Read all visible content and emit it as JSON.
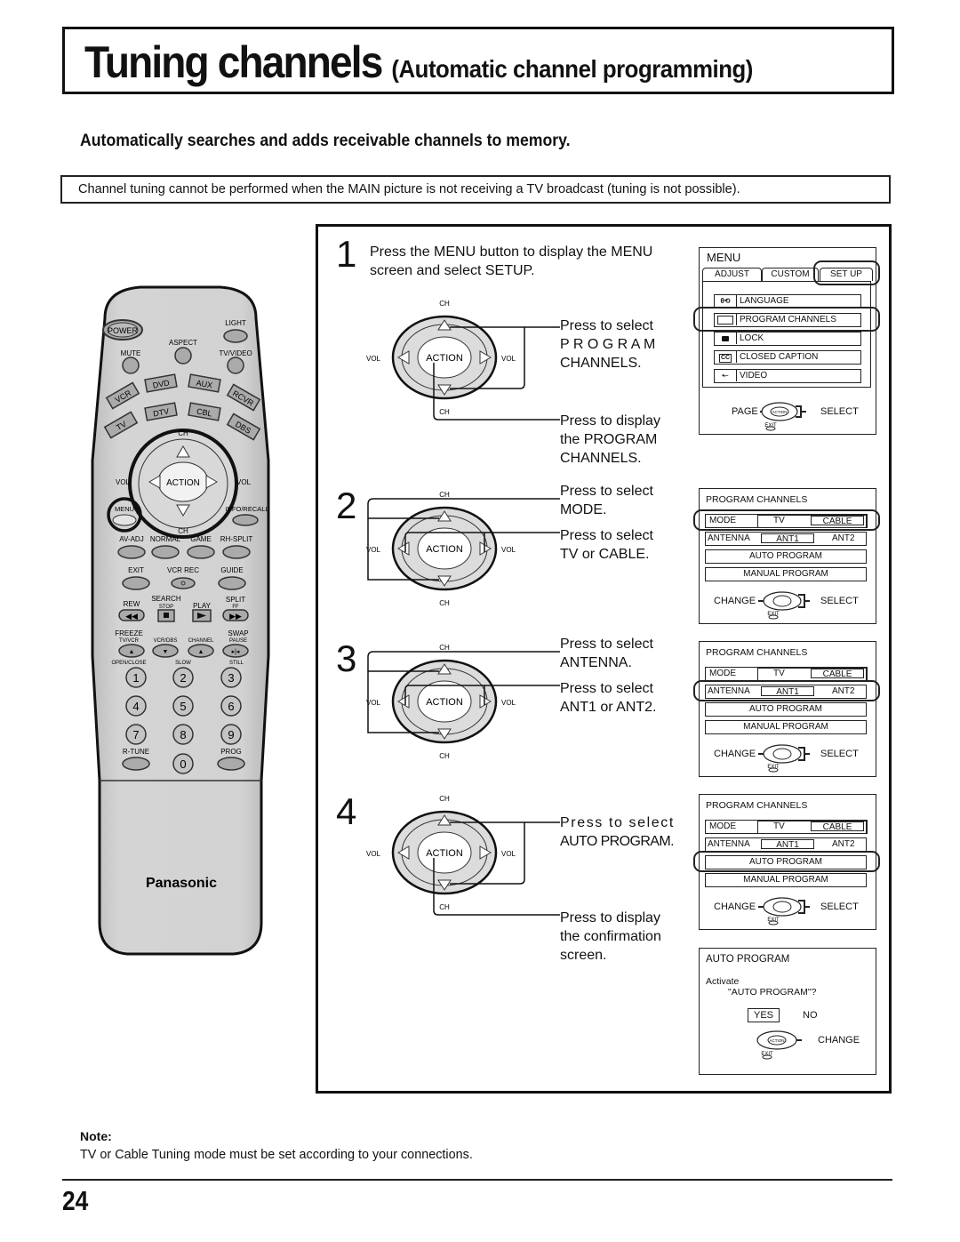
{
  "header": {
    "title": "Tuning channels",
    "subtitle": "(Automatic channel programming)"
  },
  "subheading": "Automatically searches and adds receivable channels to memory.",
  "notice": "Channel tuning cannot be performed when the MAIN picture is not receiving a TV broadcast (tuning is not possible).",
  "remote": {
    "brand": "Panasonic",
    "buttons": {
      "power": "POWER",
      "light": "LIGHT",
      "aspect": "ASPECT",
      "mute": "MUTE",
      "tv_video": "TV/VIDEO",
      "vcr": "VCR",
      "dvd": "DVD",
      "aux": "AUX",
      "rcvr": "RCVR",
      "tv": "TV",
      "dtv": "DTV",
      "cbl": "CBL",
      "dbs": "DBS",
      "ch": "CH",
      "vol": "VOL",
      "action": "ACTION",
      "menu": "MENU",
      "info_recall": "INFO/RECALL",
      "av_adj": "AV-ADJ",
      "normal": "NORMAL",
      "game": "GAME",
      "rh_split": "RH-SPLIT",
      "exit": "EXIT",
      "vcr_rec": "VCR REC",
      "guide": "GUIDE",
      "rew": "REW",
      "search": "SEARCH",
      "stop": "STOP",
      "play": "PLAY",
      "split": "SPLIT",
      "ff": "FF",
      "freeze": "FREEZE",
      "tv_vcr": "TV/VCR",
      "vcr_dbs": "VCR/DBS",
      "channel": "CHANNEL",
      "swap": "SWAP",
      "pause": "PAUSE",
      "open_close": "OPEN/CLOSE",
      "slow": "SLOW",
      "still": "STILL",
      "r_tune": "R-TUNE",
      "prog": "PROG",
      "digits": [
        "1",
        "2",
        "3",
        "4",
        "5",
        "6",
        "7",
        "8",
        "9",
        "0"
      ]
    }
  },
  "dpad": {
    "ch": "CH",
    "vol": "VOL",
    "action": "ACTION"
  },
  "steps": [
    {
      "number": "1",
      "instruction_line1": "Press the MENU button to display the MENU",
      "instruction_line2": "screen and select SETUP.",
      "callout_a": [
        "Press to select",
        "P R O G R A M",
        "CHANNELS."
      ],
      "callout_b": [
        "Press to display",
        "the PROGRAM",
        "CHANNELS."
      ]
    },
    {
      "number": "2",
      "callout_a": [
        "Press to select",
        "MODE."
      ],
      "callout_b": [
        "Press to select",
        "TV or CABLE."
      ]
    },
    {
      "number": "3",
      "callout_a": [
        "Press to select",
        "ANTENNA."
      ],
      "callout_b": [
        "Press to select",
        "ANT1 or ANT2."
      ]
    },
    {
      "number": "4",
      "callout_a": [
        "Press to select",
        "AUTO PROGRAM."
      ],
      "callout_b": [
        "Press to display",
        "the confirmation",
        "screen."
      ]
    }
  ],
  "menu_screen": {
    "title": "MENU",
    "tabs": [
      "ADJUST",
      "CUSTOM",
      "SET UP"
    ],
    "selected_tab": "SET UP",
    "items": [
      "LANGUAGE",
      "PROGRAM CHANNELS",
      "LOCK",
      "CLOSED CAPTION",
      "VIDEO"
    ],
    "selected_item": "PROGRAM CHANNELS",
    "footer_left": "PAGE",
    "footer_right": "SELECT",
    "exit": "EXIT",
    "action": "ACTION"
  },
  "program_channels_screen": {
    "title": "PROGRAM CHANNELS",
    "mode_label": "MODE",
    "mode_options": [
      "TV",
      "CABLE"
    ],
    "mode_selected": "CABLE",
    "antenna_label": "ANTENNA",
    "antenna_options": [
      "ANT1",
      "ANT2"
    ],
    "antenna_selected": "ANT1",
    "auto_program": "AUTO PROGRAM",
    "manual_program": "MANUAL PROGRAM",
    "footer_left": "CHANGE",
    "footer_right": "SELECT",
    "exit": "EXIT"
  },
  "confirm_screen": {
    "title": "AUTO PROGRAM",
    "line1": "Activate",
    "line2": "\"AUTO PROGRAM\"?",
    "yes": "YES",
    "no": "NO",
    "footer_right": "CHANGE",
    "exit": "EXIT",
    "action": "ACTION"
  },
  "note": {
    "heading": "Note:",
    "text": "TV or Cable Tuning mode must be set according to your connections."
  },
  "page_number": "24"
}
